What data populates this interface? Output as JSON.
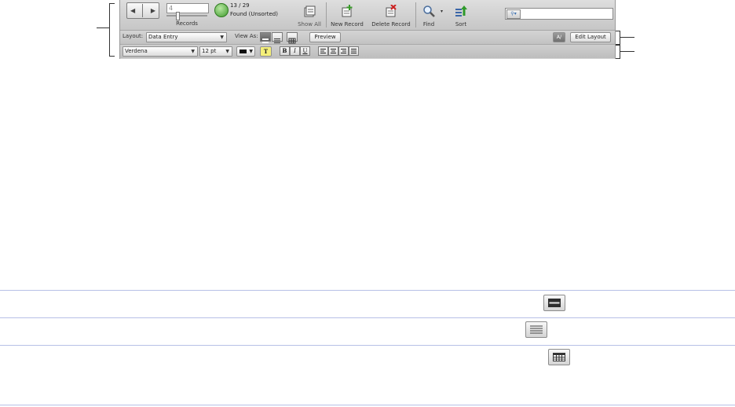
{
  "status_toolbar": {
    "record_field_value": "4",
    "records_label": "Records",
    "found_count": "13 / 29",
    "found_status": "Found (Unsorted)",
    "buttons": {
      "show_all": "Show All",
      "new_record": "New Record",
      "delete_record": "Delete Record",
      "find": "Find",
      "sort": "Sort"
    },
    "quick_find_value": ""
  },
  "layout_bar": {
    "layout_label": "Layout:",
    "layout_selected": "Data Entry",
    "view_as_label": "View As:",
    "preview_label": "Preview",
    "edit_layout_label": "Edit Layout"
  },
  "formatting_bar": {
    "font": "Verdena",
    "size": "12 pt",
    "text_color_glyph": "T",
    "bold": "B",
    "italic": "I",
    "underline": "U"
  },
  "view_icons": [
    "form-view-icon",
    "list-view-icon",
    "table-view-icon"
  ],
  "colors": {
    "toolbar_bg": "#d2d2d2",
    "table_rule": "#b7c0e6",
    "found_pie": "#3f9a2d",
    "highlight_yellow": "#f5f07a"
  }
}
